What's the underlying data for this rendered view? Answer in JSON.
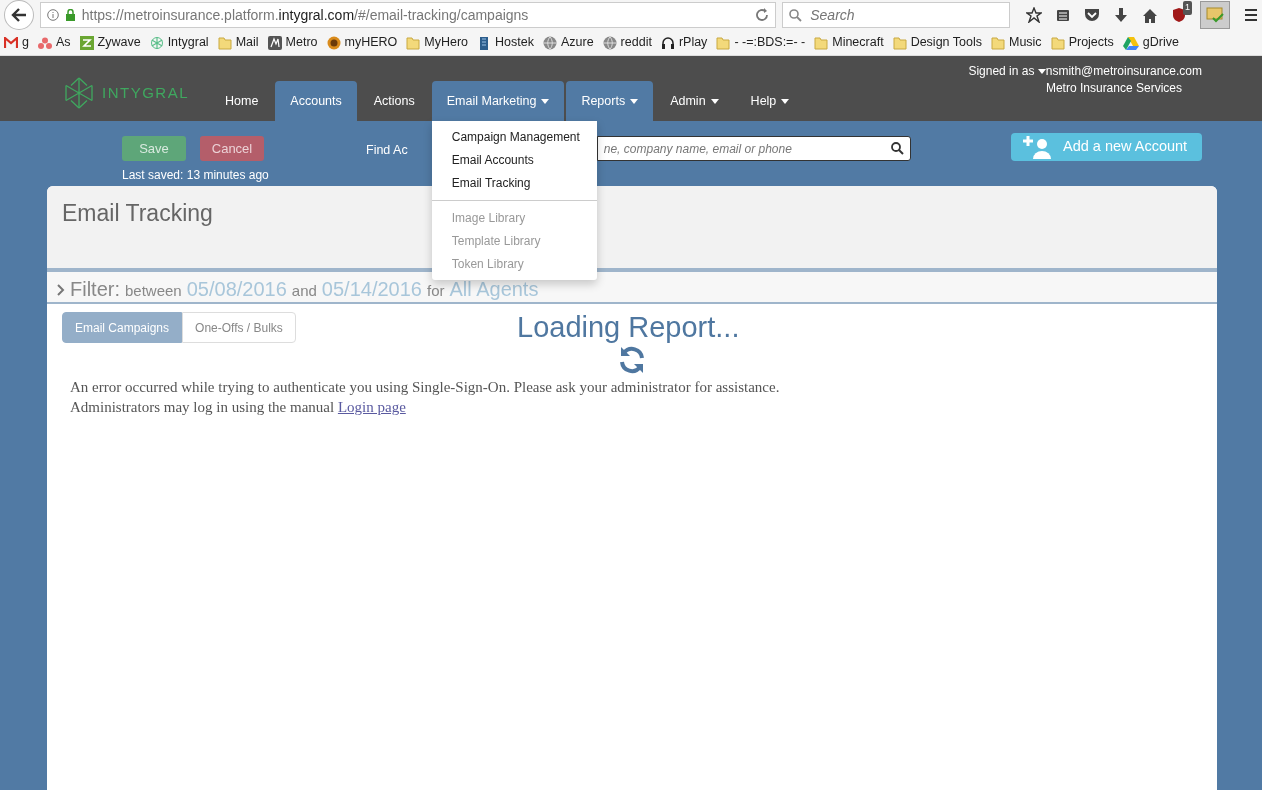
{
  "browser": {
    "url_prefix": "https://metroinsurance.platform.",
    "url_domain": "intygral.com",
    "url_suffix": "/#/email-tracking/campaigns",
    "search_placeholder": "Search",
    "addon_badge": "1",
    "bookmarks": [
      {
        "label": "g",
        "kind": "gmail"
      },
      {
        "label": "As",
        "kind": "asana"
      },
      {
        "label": "Zywave",
        "kind": "zywave"
      },
      {
        "label": "Intygral",
        "kind": "intygral"
      },
      {
        "label": "Mail",
        "kind": "folder"
      },
      {
        "label": "Metro",
        "kind": "metro"
      },
      {
        "label": "myHERO",
        "kind": "hero"
      },
      {
        "label": "MyHero",
        "kind": "folder"
      },
      {
        "label": "Hostek",
        "kind": "hostek"
      },
      {
        "label": "Azure",
        "kind": "globe"
      },
      {
        "label": "reddit",
        "kind": "globe"
      },
      {
        "label": "rPlay",
        "kind": "headphones"
      },
      {
        "label": "- -=:BDS:=- -",
        "kind": "folder"
      },
      {
        "label": "Minecraft",
        "kind": "folder"
      },
      {
        "label": "Design Tools",
        "kind": "folder"
      },
      {
        "label": "Music",
        "kind": "folder"
      },
      {
        "label": "Projects",
        "kind": "folder"
      },
      {
        "label": "gDrive",
        "kind": "drive"
      }
    ]
  },
  "app": {
    "logo": "INTYGRAL",
    "nav": [
      {
        "label": "Home",
        "highlighted": false,
        "expanded": false,
        "dropdown": false
      },
      {
        "label": "Accounts",
        "highlighted": true,
        "expanded": false,
        "dropdown": false
      },
      {
        "label": "Actions",
        "highlighted": false,
        "expanded": false,
        "dropdown": false
      },
      {
        "label": "Email Marketing",
        "highlighted": true,
        "expanded": true,
        "dropdown": true
      },
      {
        "label": "Reports",
        "highlighted": true,
        "expanded": false,
        "dropdown": true
      },
      {
        "label": "Admin",
        "highlighted": false,
        "expanded": false,
        "dropdown": true
      },
      {
        "label": "Help",
        "highlighted": false,
        "expanded": false,
        "dropdown": true
      }
    ],
    "user": {
      "signed_in_label": "Signed in as",
      "email": "nsmith@metroinsurance.com",
      "company": "Metro Insurance Services"
    },
    "menu": [
      [
        {
          "label": "Campaign Management",
          "disabled": false
        },
        {
          "label": "Email Accounts",
          "disabled": false
        },
        {
          "label": "Email Tracking",
          "disabled": false
        }
      ],
      [
        {
          "label": "Image Library",
          "disabled": true
        },
        {
          "label": "Template Library",
          "disabled": true
        },
        {
          "label": "Token Library",
          "disabled": true
        }
      ]
    ]
  },
  "toolbar": {
    "save": "Save",
    "cancel": "Cancel",
    "last_saved": "Last saved: 13 minutes ago",
    "find_label": "Find Ac",
    "find_placeholder": "ne, company name, email or phone",
    "add_button": "Add a new Account"
  },
  "page": {
    "title": "Email Tracking",
    "filter": {
      "label": "Filter:",
      "between": "between",
      "start": "05/08/2016",
      "and": "and",
      "end": "05/14/2016",
      "for": "for",
      "agents": "All Agents"
    },
    "tabs": [
      {
        "label": "Email Campaigns",
        "selected": true
      },
      {
        "label": "One-Offs / Bulks",
        "selected": false
      }
    ],
    "loading": "Loading Report...",
    "error_line1": "An error occurred while trying to authenticate you using Single-Sign-On. Please ask your administrator for assistance.",
    "error_line2": "Administrators may log in using the manual",
    "login_link": "Login page"
  }
}
